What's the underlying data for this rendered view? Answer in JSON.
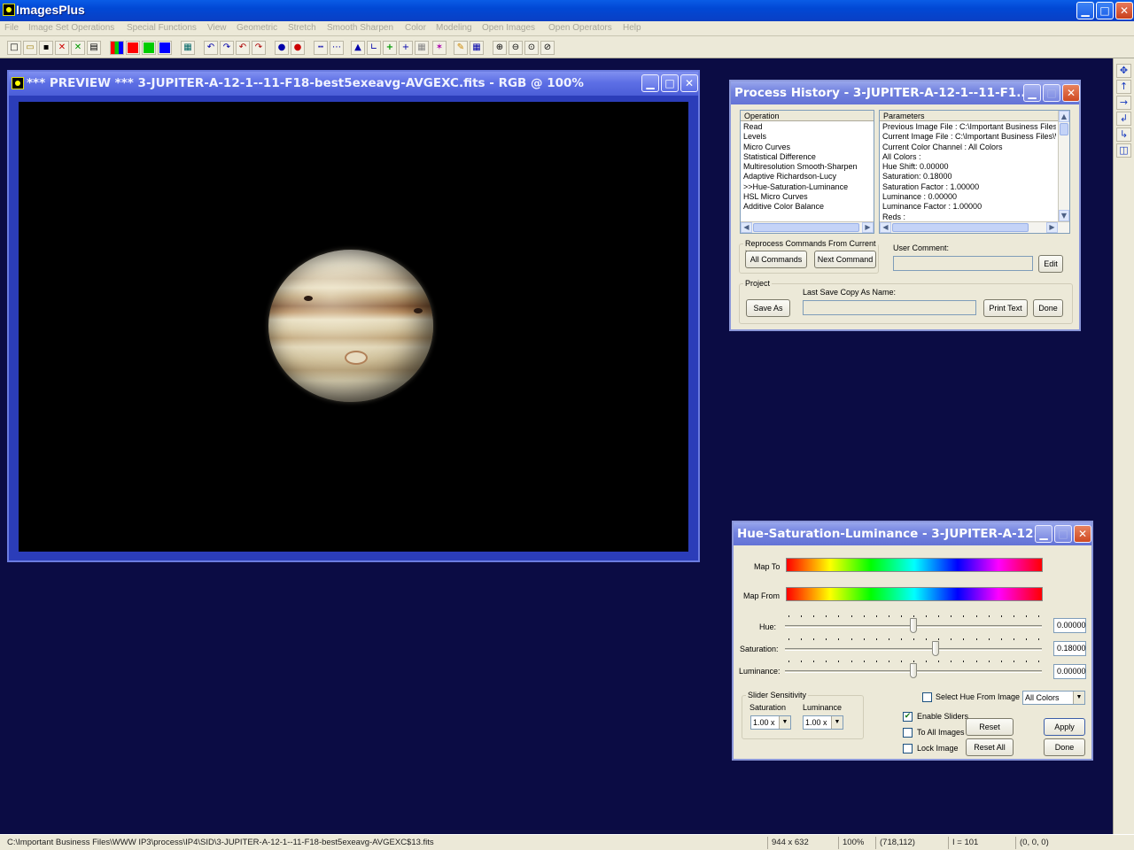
{
  "app": {
    "title": "ImagesPlus"
  },
  "menu": [
    "File",
    "Image Set Operations",
    "Special Functions",
    "View",
    "Geometric",
    "Stretch",
    "Smooth Sharpen",
    "Color",
    "Modeling",
    "Open Images",
    "Open Operators",
    "Help"
  ],
  "toolbar": {
    "icons": [
      "new-icon",
      "open-icon",
      "save-icon",
      "close-icon",
      "close-green-icon",
      "print-icon",
      "rgb-icon",
      "red-channel-icon",
      "green-channel-icon",
      "blue-channel-icon",
      "calculator-icon",
      "undo-icon",
      "redo-icon",
      "undo-all-icon",
      "redo-all-icon",
      "point-icon",
      "point-red-icon",
      "line-icon",
      "histogram-icon",
      "axis-icon",
      "crosshair-icon",
      "grid-icon",
      "stars-icon",
      "pencil-icon",
      "table-icon",
      "zoom-in-icon",
      "zoom-out-icon",
      "zoom-fit-icon",
      "zoom-reset-icon"
    ],
    "channel_colors": {
      "red": "#ff0000",
      "green": "#00cc00",
      "blue": "#0000ff"
    }
  },
  "preview": {
    "title": "*** PREVIEW *** 3-JUPITER-A-12-1--11-F18-best5exeavg-AVGEXC.fits - RGB @  100%"
  },
  "process_history": {
    "title": "Process History - 3-JUPITER-A-12-1--11-F1...",
    "operation_header": "Operation",
    "operations": [
      "Read",
      "Levels",
      "Micro Curves",
      "Statistical Difference",
      "Multiresolution Smooth-Sharpen",
      "Adaptive Richardson-Lucy",
      ">>Hue-Saturation-Luminance",
      "HSL Micro Curves",
      "Additive Color Balance"
    ],
    "parameters_header": "Parameters",
    "parameters": [
      "Previous Image File : C:\\Important Business Files\\W\\",
      "Current Image File : C:\\Important Business Files\\W\\",
      "Current Color Channel : All Colors",
      "All Colors :",
      "Hue Shift: 0.00000",
      "Saturation: 0.18000",
      "Saturation Factor : 1.00000",
      "Luminance : 0.00000",
      "Luminance Factor : 1.00000",
      "Reds :"
    ],
    "reprocess_label": "Reprocess Commands From Current >>",
    "all_commands_button": "All Commands",
    "next_command_button": "Next Command",
    "user_comment_label": "User Comment:",
    "user_comment_value": "",
    "edit_button": "Edit",
    "project_label": "Project",
    "last_save_label": "Last Save Copy As Name:",
    "last_save_value": "",
    "save_as_button": "Save As",
    "print_text_button": "Print Text",
    "done_button": "Done"
  },
  "hsl": {
    "title": "Hue-Saturation-Luminance - 3-JUPITER-A-12...",
    "map_to_label": "Map To",
    "map_from_label": "Map From",
    "hue_label": "Hue:",
    "hue_value": "0.00000",
    "saturation_label": "Saturation:",
    "saturation_value": "0.18000",
    "luminance_label": "Luminance:",
    "luminance_value": "0.00000",
    "slider_positions": {
      "hue": 0.5,
      "saturation": 0.59,
      "luminance": 0.5
    },
    "slider_sensitivity_label": "Slider Sensitivity",
    "sens_saturation_label": "Saturation",
    "sens_luminance_label": "Luminance",
    "sens_saturation_value": "1.00 x",
    "sens_luminance_value": "1.00 x",
    "select_hue_label": "Select Hue From Image",
    "select_hue_checked": false,
    "color_select_value": "All Colors",
    "enable_sliders_label": "Enable Sliders",
    "enable_sliders_checked": true,
    "to_all_images_label": "To All Images",
    "to_all_images_checked": false,
    "lock_image_label": "Lock Image",
    "lock_image_checked": false,
    "reset_button": "Reset",
    "apply_button": "Apply",
    "reset_all_button": "Reset All",
    "done_button": "Done"
  },
  "statusbar": {
    "path": "C:\\Important Business Files\\WWW IP3\\process\\IP4\\SID\\3-JUPITER-A-12-1--11-F18-best5exeavg-AVGEXC$13.fits",
    "dimensions": "944 x 632",
    "zoom": "100%",
    "coords": "(718,112)",
    "intensity": "I = 101",
    "rgb": "(0, 0, 0)"
  }
}
